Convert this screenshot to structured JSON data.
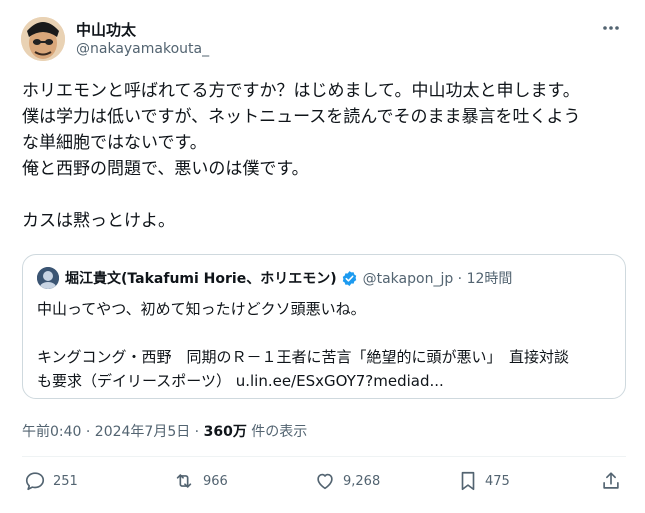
{
  "author": {
    "name": "中山功太",
    "handle": "@nakayamakouta_"
  },
  "tweet": {
    "text": "ホリエモンと呼ばれてる方ですか？はじめまして。中山功太と申します。\n僕は学力は低いですが、ネットニュースを読んでそのまま暴言を吐くよう\nな単細胞ではないです。\n俺と西野の問題で、悪いのは僕です。\n\nカスは黙っとけよ。"
  },
  "quote": {
    "name": "堀江貴文(Takafumi Horie、ホリエモン)",
    "meta": "@takapon_jp · 12時間",
    "text": "中山ってやつ、初めて知ったけどクソ頭悪いね。\n\nキングコング・西野　同期のＲ－１王者に苦言「絶望的に頭が悪い」　直接対談\nも要求（デイリースポーツ） u.lin.ee/ESxGOY7?mediad..."
  },
  "meta": {
    "timestamp": "午前0:40 · 2024年7月5日 · ",
    "views": "360万",
    "views_suffix": " 件の表示"
  },
  "actions": {
    "replies": "251",
    "reposts": "966",
    "likes": "9,268",
    "bookmarks": "475"
  },
  "colors": {
    "text": "#0f1419",
    "secondary": "#536471",
    "border": "#cfd9de",
    "verified": "#1d9bf0"
  }
}
